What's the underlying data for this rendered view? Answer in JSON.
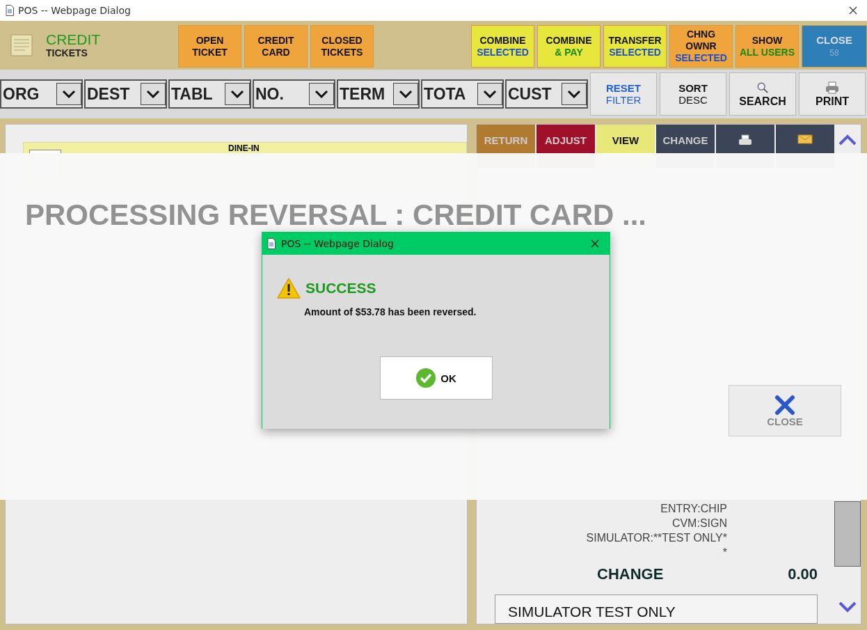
{
  "window": {
    "title": "POS -- Webpage Dialog"
  },
  "header": {
    "title": "CREDIT",
    "subtitle": "TICKETS",
    "left_buttons": [
      {
        "line1": "OPEN",
        "line2": "TICKET",
        "color": "#f0a43c",
        "kind": "plain"
      },
      {
        "line1": "CREDIT",
        "line2": "CARD",
        "color": "#f0a43c",
        "kind": "plain"
      },
      {
        "line1": "CLOSED",
        "line2": "TICKETS",
        "color": "#f0a43c",
        "kind": "plain"
      }
    ],
    "right_buttons": [
      {
        "line1": "COMBINE",
        "line2": "SELECTED",
        "color": "#e6e63c",
        "kind": "select"
      },
      {
        "line1": "COMBINE",
        "line2": "& PAY",
        "color": "#e6e63c",
        "kind": "pay"
      },
      {
        "line1": "TRANSFER",
        "line2": "SELECTED",
        "color": "#e6e63c",
        "kind": "select"
      },
      {
        "line1": "CHNG OWNR",
        "line2": "SELECTED",
        "color": "#f0a43c",
        "kind": "select"
      },
      {
        "line1": "SHOW",
        "line2": "ALL USERS",
        "color": "#f0a43c",
        "kind": "pay"
      },
      {
        "line1": "CLOSE",
        "line2": "58",
        "color": "#2e7fb8",
        "kind": "close"
      }
    ]
  },
  "filters": [
    {
      "label": "ORG"
    },
    {
      "label": "DEST"
    },
    {
      "label": "TABL"
    },
    {
      "label": "NO."
    },
    {
      "label": "TERM"
    },
    {
      "label": "TOTA"
    },
    {
      "label": "CUST"
    }
  ],
  "filter_actions": [
    {
      "line1": "RESET",
      "line2": "FILTER",
      "kind": "reset"
    },
    {
      "line1": "SORT",
      "line2": "DESC",
      "kind": "sort"
    },
    {
      "line1": "SEARCH",
      "kind": "search"
    },
    {
      "line1": "PRINT",
      "kind": "print"
    }
  ],
  "ticket_row": {
    "label": "DINE-IN",
    "checked": false
  },
  "detail_actions": [
    {
      "label": "RETURN",
      "color": "#b07a30",
      "kind": "text"
    },
    {
      "label": "ADJUST",
      "color": "#a0102a",
      "kind": "text"
    },
    {
      "label": "VIEW",
      "color": "#e8e878",
      "kind": "dark"
    },
    {
      "label": "CHANGE",
      "color": "#3c4458",
      "kind": "text"
    },
    {
      "color": "#3c4458",
      "kind": "print"
    },
    {
      "color": "#3c4458",
      "kind": "email"
    }
  ],
  "receipt_lines": [
    "ENTRY:CHIP",
    "CVM:SIGN",
    "SIMULATOR:**TEST ONLY*",
    "*"
  ],
  "change": {
    "label": "CHANGE",
    "value": "0.00"
  },
  "note": "SIMULATOR TEST ONLY",
  "overlay": {
    "message": "PROCESSING REVERSAL : CREDIT CARD ...",
    "close_label": "CLOSE"
  },
  "dialog": {
    "title": "POS -- Webpage Dialog",
    "heading": "SUCCESS",
    "message": "Amount of $53.78 has been reversed.",
    "ok": "OK"
  }
}
